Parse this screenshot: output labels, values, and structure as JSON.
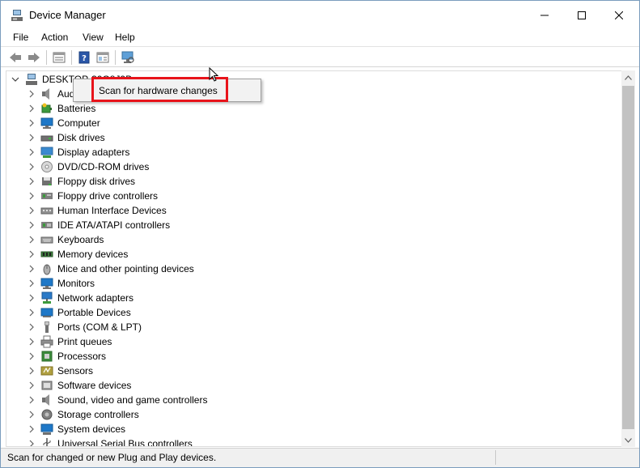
{
  "window": {
    "title": "Device Manager",
    "controls": {
      "minimize": "—",
      "maximize": "☐",
      "close": "✕"
    }
  },
  "menu": {
    "file": "File",
    "action": "Action",
    "view": "View",
    "help": "Help"
  },
  "toolbar": {
    "buttons": [
      "back-icon",
      "forward-icon",
      "properties-icon",
      "help-icon",
      "show-hide-console-icon",
      "scan-hardware-icon"
    ]
  },
  "tree": {
    "root": "DESKTOP-30G8J9B",
    "items": [
      {
        "label": "Audio inputs and outputs",
        "icon": "speaker-icon"
      },
      {
        "label": "Batteries",
        "icon": "battery-icon"
      },
      {
        "label": "Computer",
        "icon": "computer-icon"
      },
      {
        "label": "Disk drives",
        "icon": "disk-drive-icon"
      },
      {
        "label": "Display adapters",
        "icon": "display-adapter-icon"
      },
      {
        "label": "DVD/CD-ROM drives",
        "icon": "dvd-icon"
      },
      {
        "label": "Floppy disk drives",
        "icon": "floppy-disk-icon"
      },
      {
        "label": "Floppy drive controllers",
        "icon": "floppy-controller-icon"
      },
      {
        "label": "Human Interface Devices",
        "icon": "hid-icon"
      },
      {
        "label": "IDE ATA/ATAPI controllers",
        "icon": "ide-controller-icon"
      },
      {
        "label": "Keyboards",
        "icon": "keyboard-icon"
      },
      {
        "label": "Memory devices",
        "icon": "memory-icon"
      },
      {
        "label": "Mice and other pointing devices",
        "icon": "mouse-icon"
      },
      {
        "label": "Monitors",
        "icon": "monitor-icon"
      },
      {
        "label": "Network adapters",
        "icon": "network-adapter-icon"
      },
      {
        "label": "Portable Devices",
        "icon": "portable-device-icon"
      },
      {
        "label": "Ports (COM & LPT)",
        "icon": "port-icon"
      },
      {
        "label": "Print queues",
        "icon": "printer-icon"
      },
      {
        "label": "Processors",
        "icon": "processor-icon"
      },
      {
        "label": "Sensors",
        "icon": "sensor-icon"
      },
      {
        "label": "Software devices",
        "icon": "software-device-icon"
      },
      {
        "label": "Sound, video and game controllers",
        "icon": "sound-icon"
      },
      {
        "label": "Storage controllers",
        "icon": "storage-controller-icon"
      },
      {
        "label": "System devices",
        "icon": "system-device-icon"
      },
      {
        "label": "Universal Serial Bus controllers",
        "icon": "usb-icon"
      }
    ]
  },
  "context_menu": {
    "scan": "Scan for hardware changes"
  },
  "status": {
    "text": "Scan for changed or new Plug and Play devices."
  },
  "colors": {
    "highlight_border": "#e8141b",
    "scroll_thumb": "#c2c2c2",
    "status_bg": "#f0f0f0"
  }
}
